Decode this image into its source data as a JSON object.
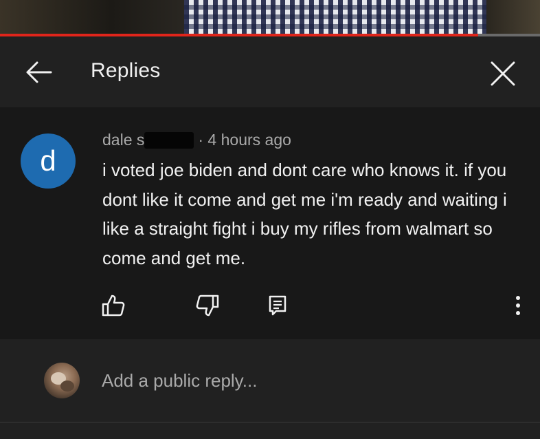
{
  "player": {
    "progress_fraction": 0.885,
    "progress_color": "#e1251b"
  },
  "header": {
    "title": "Replies",
    "back_icon": "arrow-left-icon",
    "close_icon": "close-icon",
    "background": "#212121"
  },
  "comment": {
    "avatar_letter": "d",
    "avatar_color": "#1e6bb0",
    "author": "dale s",
    "author_redacted": true,
    "timestamp": "· 4 hours ago",
    "text": "i voted joe biden and dont care who knows it. if you dont like it come and get me i'm ready and waiting i like a straight fight i buy my rifles from walmart so come and get me.",
    "actions": [
      {
        "name": "like-button",
        "icon": "thumbs-up-icon"
      },
      {
        "name": "dislike-button",
        "icon": "thumbs-down-icon"
      },
      {
        "name": "reply-button",
        "icon": "comment-icon"
      },
      {
        "name": "more-options-button",
        "icon": "more-vertical-icon"
      }
    ]
  },
  "reply_box": {
    "placeholder": "Add a public reply...",
    "value": ""
  }
}
